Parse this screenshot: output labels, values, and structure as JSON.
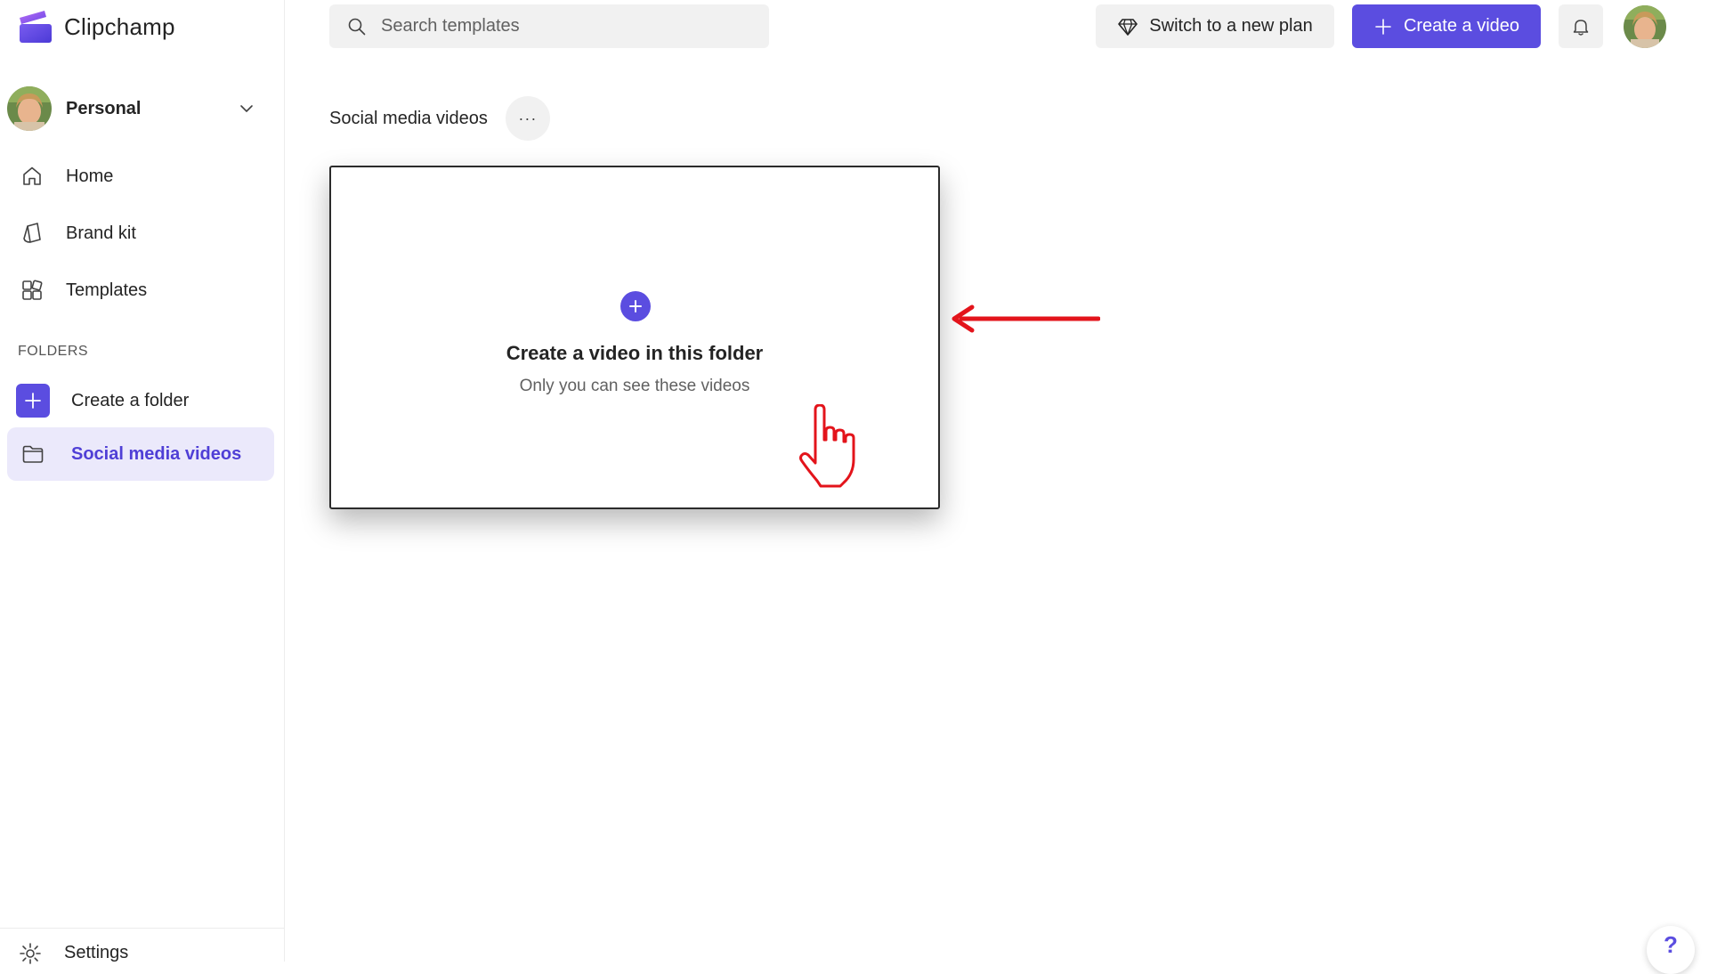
{
  "app": {
    "name": "Clipchamp"
  },
  "sidebar": {
    "workspace": "Personal",
    "nav_items": [
      {
        "label": "Home",
        "icon": "home-icon"
      },
      {
        "label": "Brand kit",
        "icon": "brand-kit-icon"
      },
      {
        "label": "Templates",
        "icon": "templates-icon"
      }
    ],
    "folders_heading": "FOLDERS",
    "folders": [
      {
        "label": "Create a folder",
        "icon": "plus-icon"
      },
      {
        "label": "Social media videos",
        "icon": "folder-icon",
        "active": true
      }
    ],
    "settings_label": "Settings"
  },
  "topbar": {
    "search_placeholder": "Search templates",
    "plan_button": "Switch to a new plan",
    "create_button": "Create a video"
  },
  "main": {
    "title": "Social media videos",
    "more_label": "···",
    "card": {
      "title": "Create a video in this folder",
      "subtitle": "Only you can see these videos"
    }
  },
  "help": {
    "label": "?"
  },
  "colors": {
    "accent": "#5b4de0",
    "active_bg": "#ebe9fb",
    "active_text": "#4f3fd6",
    "annotation_red": "#e3141b"
  }
}
